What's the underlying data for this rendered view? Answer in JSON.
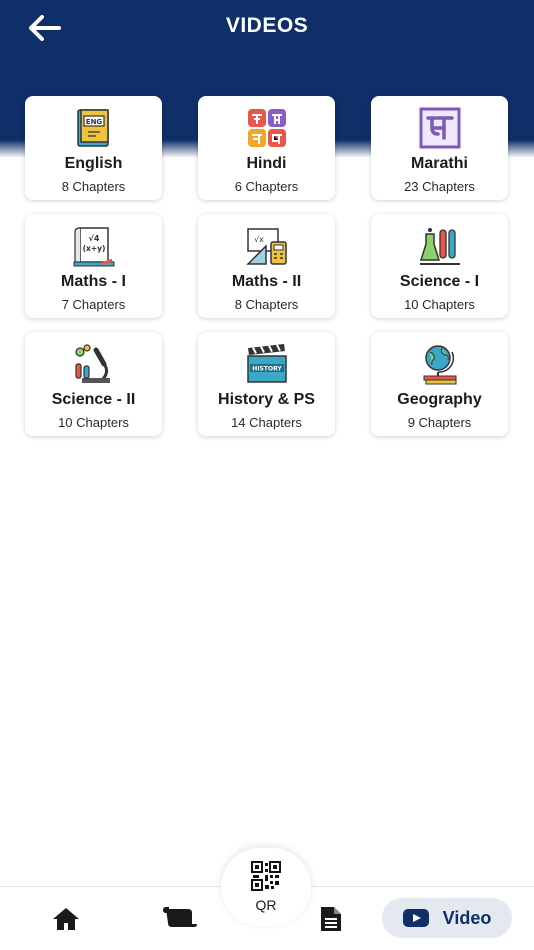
{
  "header": {
    "title": "VIDEOS",
    "back_icon": "arrow-left-icon",
    "background": "#0f2f68"
  },
  "subjects": [
    {
      "name": "English",
      "chapters": "8 Chapters",
      "icon": "english-book-icon"
    },
    {
      "name": "Hindi",
      "chapters": "6 Chapters",
      "icon": "hindi-letters-icon"
    },
    {
      "name": "Marathi",
      "chapters": "23 Chapters",
      "icon": "marathi-letter-icon"
    },
    {
      "name": "Maths - I",
      "chapters": "7 Chapters",
      "icon": "maths-formula-icon"
    },
    {
      "name": "Maths - II",
      "chapters": "8 Chapters",
      "icon": "geometry-tools-icon"
    },
    {
      "name": "Science - I",
      "chapters": "10 Chapters",
      "icon": "chemistry-lab-icon"
    },
    {
      "name": "Science - II",
      "chapters": "10 Chapters",
      "icon": "microscope-icon"
    },
    {
      "name": "History & PS",
      "chapters": "14 Chapters",
      "icon": "history-clapper-icon"
    },
    {
      "name": "Geography",
      "chapters": "9 Chapters",
      "icon": "globe-books-icon"
    }
  ],
  "bottom_nav": {
    "home_icon": "home-icon",
    "scroll_icon": "scroll-icon",
    "qr_label": "QR",
    "document_icon": "document-icon",
    "video_label": "Video",
    "video_icon": "youtube-play-icon",
    "active": "Video"
  }
}
